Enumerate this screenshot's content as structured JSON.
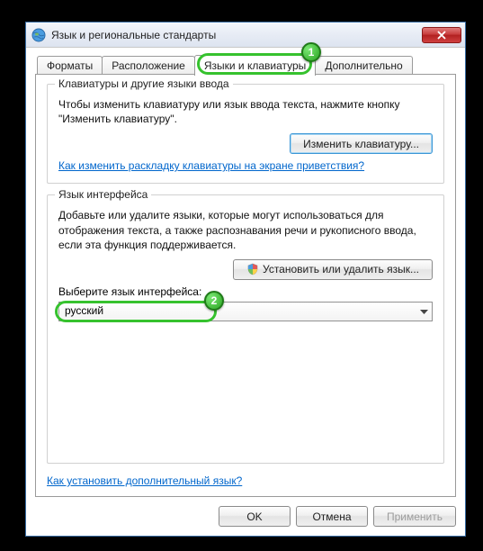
{
  "window": {
    "title": "Язык и региональные стандарты"
  },
  "tabs": {
    "formats": "Форматы",
    "location": "Расположение",
    "keyboards": "Языки и клавиатуры",
    "advanced": "Дополнительно"
  },
  "group_keyboards": {
    "legend": "Клавиатуры и другие языки ввода",
    "desc": "Чтобы изменить клавиатуру или язык ввода текста, нажмите кнопку \"Изменить клавиатуру\".",
    "change_btn": "Изменить клавиатуру...",
    "link": "Как изменить раскладку клавиатуры на экране приветствия?"
  },
  "group_ui_lang": {
    "legend": "Язык интерфейса",
    "desc": "Добавьте или удалите языки, которые могут использоваться для отображения текста, а также распознавания речи и рукописного ввода, если эта функция поддерживается.",
    "install_btn": "Установить или удалить язык...",
    "select_label": "Выберите язык интерфейса:",
    "selected": "русский"
  },
  "bottom_link": "Как установить дополнительный язык?",
  "buttons": {
    "ok": "OK",
    "cancel": "Отмена",
    "apply": "Применить"
  },
  "annotations": {
    "badge1": "1",
    "badge2": "2"
  }
}
